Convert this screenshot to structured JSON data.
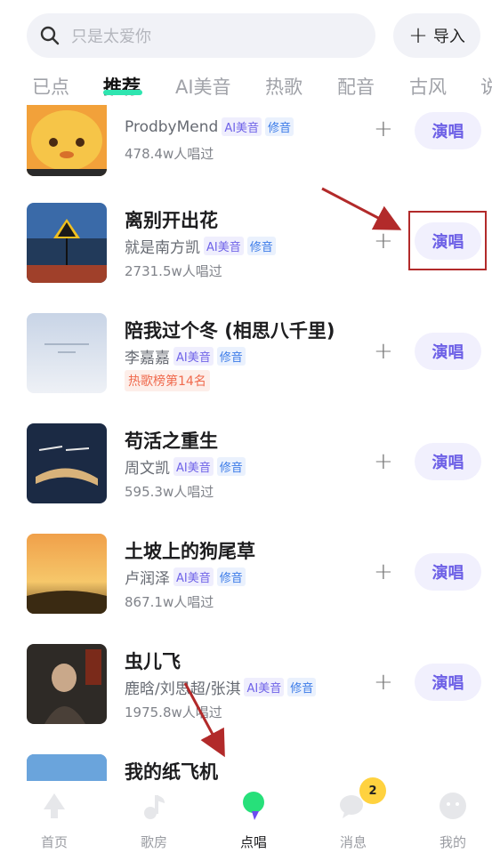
{
  "search": {
    "placeholder": "只是太爱你",
    "import_label": "导入"
  },
  "tabs": [
    "已点",
    "推荐",
    "AI美音",
    "热歌",
    "配音",
    "古风",
    "说"
  ],
  "tags": {
    "ai": "AI美音",
    "fix": "修音"
  },
  "action": {
    "sing_label": "演唱",
    "add_symbol": "+"
  },
  "songs": [
    {
      "title": "",
      "artist": "ProdbyMend",
      "plays": "478.4w人唱过"
    },
    {
      "title": "离别开出花",
      "artist": "就是南方凯",
      "plays": "2731.5w人唱过"
    },
    {
      "title": "陪我过个冬 (相思八千里)",
      "artist": "李嘉嘉",
      "rank": "热歌榜第14名"
    },
    {
      "title": "苟活之重生",
      "artist": "周文凯",
      "plays": "595.3w人唱过"
    },
    {
      "title": "土坡上的狗尾草",
      "artist": "卢润泽",
      "plays": "867.1w人唱过"
    },
    {
      "title": "虫儿飞",
      "artist": "鹿晗/刘思超/张淇",
      "plays": "1975.8w人唱过"
    },
    {
      "title": "我的纸飞机",
      "artist": "",
      "plays": ""
    }
  ],
  "nav": {
    "items": [
      "首页",
      "歌房",
      "点唱",
      "消息",
      "我的"
    ],
    "active": "点唱",
    "messages_badge": "2"
  },
  "colors": {
    "accent": "#6c5fe6",
    "tab_underline": "#2fe5b0",
    "badge": "#ffd23f",
    "annotation": "#b22a2a"
  }
}
